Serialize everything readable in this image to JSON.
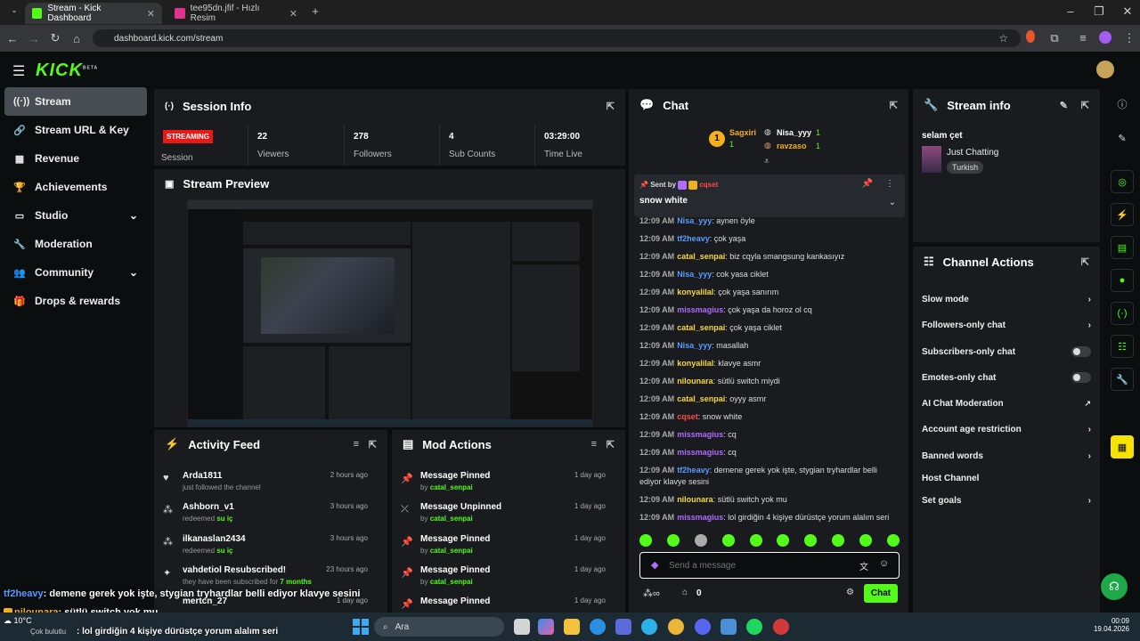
{
  "browser": {
    "tabs": [
      {
        "title": "Stream - Kick Dashboard"
      },
      {
        "title": "tee95dn.jfif - Hızlı Resim"
      }
    ],
    "url": "dashboard.kick.com/stream"
  },
  "logo": {
    "text": "KICK",
    "sup": "BETA"
  },
  "sidebar": {
    "items": [
      {
        "label": "Stream"
      },
      {
        "label": "Stream URL & Key"
      },
      {
        "label": "Revenue"
      },
      {
        "label": "Achievements"
      },
      {
        "label": "Studio"
      },
      {
        "label": "Moderation"
      },
      {
        "label": "Community"
      },
      {
        "label": "Drops & rewards"
      }
    ]
  },
  "session": {
    "title": "Session Info",
    "status": "STREAMING",
    "status_label": "Session",
    "stats": [
      {
        "value": "22",
        "label": "Viewers"
      },
      {
        "value": "278",
        "label": "Followers"
      },
      {
        "value": "4",
        "label": "Sub Counts"
      },
      {
        "value": "03:29:00",
        "label": "Time Live"
      }
    ]
  },
  "preview": {
    "title": "Stream Preview"
  },
  "activity": {
    "title": "Activity Feed",
    "items": [
      {
        "name": "Arda1811",
        "sub": "just followed the channel",
        "highlight": "",
        "ago": "2 hours ago"
      },
      {
        "name": "Ashborn_v1",
        "sub": "redeemed",
        "highlight": "su iç",
        "ago": "3 hours ago"
      },
      {
        "name": "ilkanaslan2434",
        "sub": "redeemed",
        "highlight": "su iç",
        "ago": "3 hours ago"
      },
      {
        "name": "vahdetiol Resubscribed!",
        "sub": "they have been subscribed for",
        "highlight": "7 months",
        "ago": "23 hours ago"
      },
      {
        "name": "mertcn_27",
        "sub": "",
        "highlight": "",
        "ago": "1 day ago"
      }
    ]
  },
  "mod_actions": {
    "title": "Mod Actions",
    "items": [
      {
        "action": "Message Pinned",
        "by": "by",
        "user": "catal_senpai",
        "ago": "1 day ago"
      },
      {
        "action": "Message Unpinned",
        "by": "by",
        "user": "catal_senpai",
        "ago": "1 day ago"
      },
      {
        "action": "Message Pinned",
        "by": "by",
        "user": "catal_senpai",
        "ago": "1 day ago"
      },
      {
        "action": "Message Pinned",
        "by": "by",
        "user": "catal_senpai",
        "ago": "1 day ago"
      },
      {
        "action": "Message Pinned",
        "by": "",
        "user": "",
        "ago": "1 day ago"
      }
    ]
  },
  "chat": {
    "title": "Chat",
    "top_gifters": [
      {
        "rank": "1",
        "name": "Sagxiri",
        "count": "1"
      },
      {
        "rank": "",
        "name": "Nisa_yyy",
        "count": "1"
      },
      {
        "rank": "",
        "name": "ravzaso",
        "count": "1"
      }
    ],
    "pinned": {
      "sent_by": "Sent by",
      "user": "cqset",
      "text": "snow white"
    },
    "messages": [
      {
        "time": "12:09 AM",
        "user": "Nisa_yyy",
        "color": "#5b9bff",
        "text": "aynen öyle"
      },
      {
        "time": "12:09 AM",
        "user": "tf2heavy",
        "color": "#5b9bff",
        "text": "çok yaşa"
      },
      {
        "time": "12:09 AM",
        "user": "catal_senpai",
        "color": "#f5d742",
        "text": "biz cqyla smangsung kankasıyız"
      },
      {
        "time": "12:09 AM",
        "user": "Nisa_yyy",
        "color": "#5b9bff",
        "text": "cok yasa ciklet"
      },
      {
        "time": "12:09 AM",
        "user": "konyalilal",
        "color": "#f5d742",
        "text": "çok yaşa sanırım"
      },
      {
        "time": "12:09 AM",
        "user": "missmagius",
        "color": "#b06bff",
        "text": "çok yaşa da horoz ol cq"
      },
      {
        "time": "12:09 AM",
        "user": "catal_senpai",
        "color": "#f5d742",
        "text": "çok yaşa ciklet"
      },
      {
        "time": "12:09 AM",
        "user": "Nisa_yyy",
        "color": "#5b9bff",
        "text": "masallah"
      },
      {
        "time": "12:09 AM",
        "user": "konyalilal",
        "color": "#f5d742",
        "text": "klavye asmr"
      },
      {
        "time": "12:09 AM",
        "user": "nilounara",
        "color": "#f5d742",
        "text": "sütlü switch miydi"
      },
      {
        "time": "12:09 AM",
        "user": "catal_senpai",
        "color": "#f5d742",
        "text": "oyyy asmr"
      },
      {
        "time": "12:09 AM",
        "user": "cqset",
        "color": "#ff4b4b",
        "text": "snow white"
      },
      {
        "time": "12:09 AM",
        "user": "missmagius",
        "color": "#b06bff",
        "text": "cq"
      },
      {
        "time": "12:09 AM",
        "user": "missmagius",
        "color": "#b06bff",
        "text": "cq"
      },
      {
        "time": "12:09 AM",
        "user": "tf2heavy",
        "color": "#5b9bff",
        "text": "demene gerek yok işte, stygian tryhardlar belli ediyor klavye sesini"
      },
      {
        "time": "12:09 AM",
        "user": "nilounara",
        "color": "#f5d742",
        "text": "sütlü switch yok mu"
      },
      {
        "time": "12:09 AM",
        "user": "missmagius",
        "color": "#b06bff",
        "text": "lol girdiğin 4 kişiye dürüstçe yorum alalım seri"
      }
    ],
    "input_placeholder": "Send a message",
    "points": "0",
    "send_label": "Chat"
  },
  "stream_info": {
    "title": "Stream info",
    "stream_title": "selam çet",
    "category": "Just Chatting",
    "language": "Turkish"
  },
  "channel_actions": {
    "title": "Channel Actions",
    "items": [
      {
        "label": "Slow mode",
        "control": "arrow"
      },
      {
        "label": "Followers-only chat",
        "control": "arrow"
      },
      {
        "label": "Subscribers-only chat",
        "control": "toggle"
      },
      {
        "label": "Emotes-only chat",
        "control": "toggle"
      },
      {
        "label": "AI Chat Moderation",
        "control": "external"
      },
      {
        "label": "Account age restriction",
        "control": "arrow"
      },
      {
        "label": "Banned words",
        "control": "arrow"
      },
      {
        "label": "Host Channel",
        "control": "none"
      },
      {
        "label": "Set goals",
        "control": "arrow"
      }
    ]
  },
  "overlay_chat": [
    {
      "user": "tf2heavy",
      "text": ": demene gerek yok işte, stygian tryhardlar belli ediyor klavye sesini"
    },
    {
      "user": "nilounara",
      "text": ": sütlü switch yok mu"
    },
    {
      "user": "",
      "text": ": lol girdiğin 4 kişiye dürüstçe yorum alalım seri"
    }
  ],
  "taskbar": {
    "weather": "10°C",
    "weather_desc": "Çok bulutlu",
    "search": "Ara",
    "time": "00:09",
    "date": "19.04.2026"
  },
  "colors": {
    "accent": "#53fc18",
    "panel": "#191b1f",
    "bg": "#0b0e0f",
    "live": "#e91916"
  }
}
